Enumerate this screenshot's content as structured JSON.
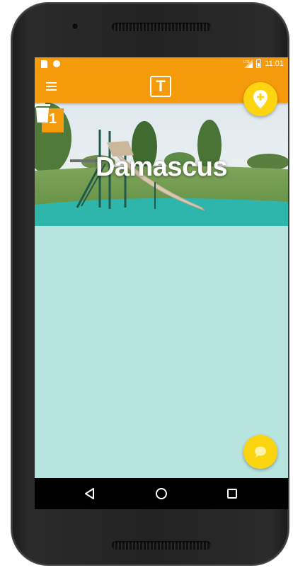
{
  "status_bar": {
    "time": "11:01",
    "network": "LTE",
    "icons": [
      "sd-card-icon",
      "notification-dot-icon",
      "signal-icon",
      "battery-icon"
    ]
  },
  "toolbar": {
    "menu_icon": "menu-icon",
    "logo_letter": "T",
    "color": "#f59a0a"
  },
  "place": {
    "number": "1",
    "name": "Damascus",
    "delete_icon": "trash-icon"
  },
  "fabs": {
    "add_place_icon": "add-location-icon",
    "chat_icon": "chat-bubble-icon",
    "color": "#fcd410"
  },
  "content": {
    "background": "#b8e4e0"
  },
  "nav_bar": {
    "buttons": [
      "back-icon",
      "home-icon",
      "recents-icon"
    ]
  }
}
